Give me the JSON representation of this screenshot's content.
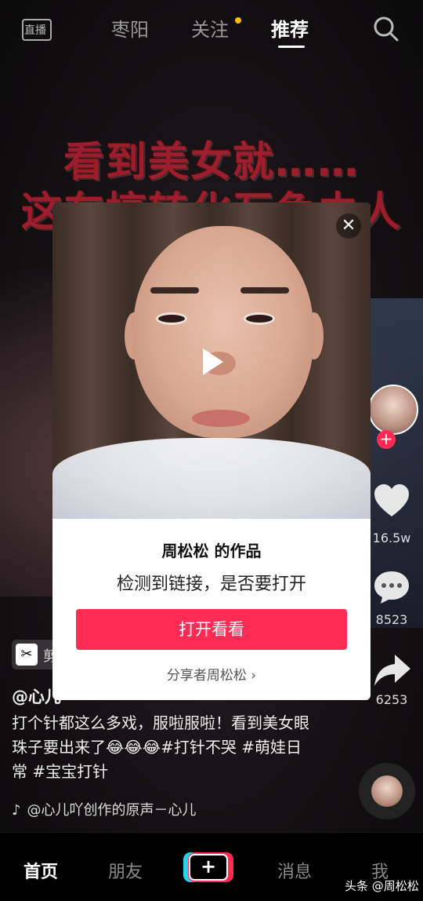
{
  "topbar": {
    "live_label": "直播",
    "tabs": [
      {
        "label": "枣阳"
      },
      {
        "label": "关注"
      },
      {
        "label": "推荐"
      }
    ]
  },
  "background": {
    "caption_line1": "看到美女就……",
    "caption_line2": "这车搞转化互免由人"
  },
  "rail": {
    "likes": "16.5w",
    "comments": "8523",
    "shares": "6253"
  },
  "info": {
    "jy_label": "剪",
    "author": "@心儿",
    "description": "打个针都这么多戏，服啦服啦！看到美女眼珠子要出来了😂😂😂#打针不哭 #萌娃日常 #宝宝打针",
    "music": "@心儿吖创作的原声－心儿"
  },
  "modal": {
    "close": "✕",
    "title": "周松松 的作品",
    "subtitle": "检测到链接，是否要打开",
    "open_button": "打开看看",
    "sharer": "分享者周松松 ›"
  },
  "nav": {
    "home": "首页",
    "friends": "朋友",
    "plus": "+",
    "messages": "消息",
    "me": "我"
  },
  "watermark": "头条 @周松松",
  "colors": {
    "accent": "#fe2c55",
    "follow_dot": "#f5c000"
  }
}
